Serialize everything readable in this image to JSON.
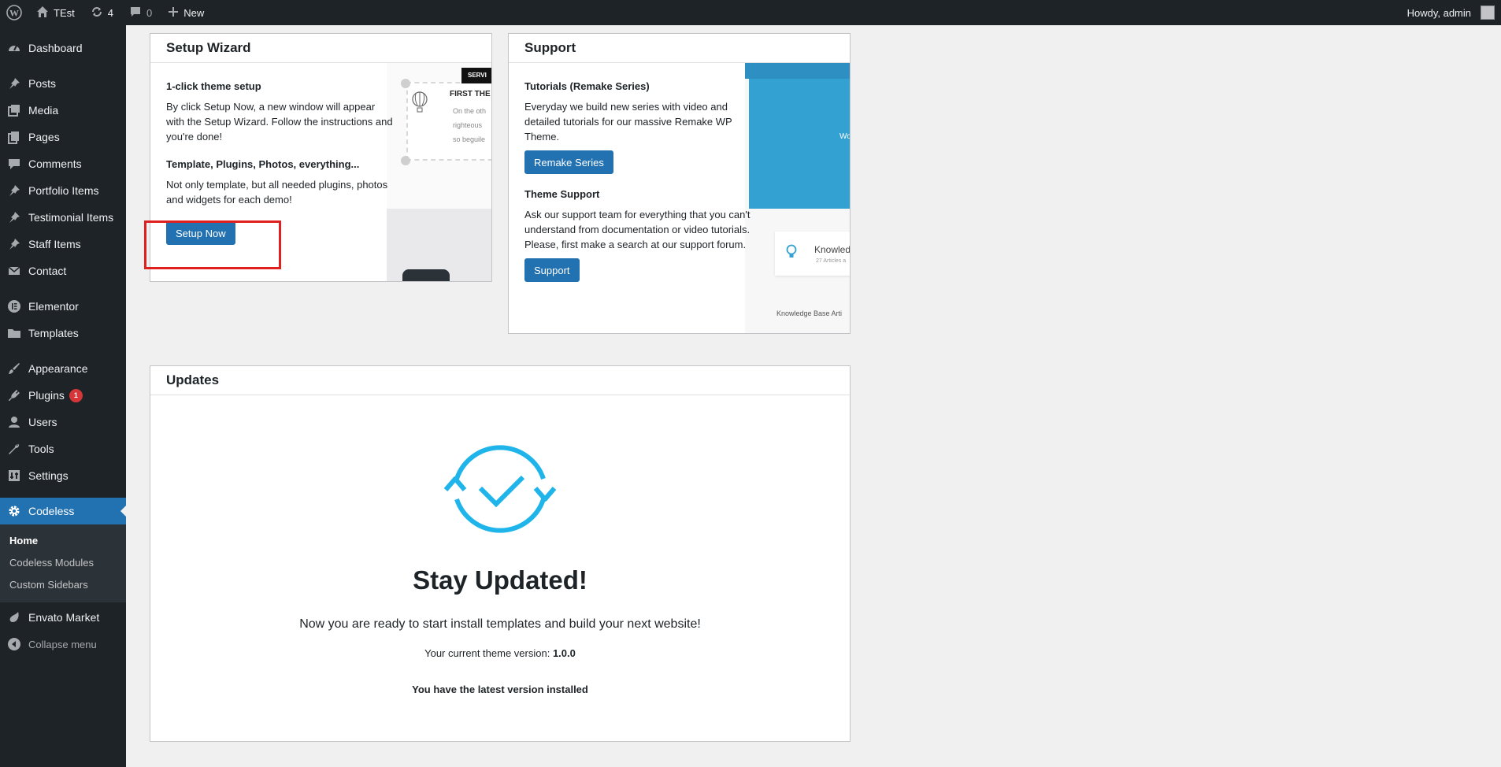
{
  "admin_bar": {
    "site_name": "TEst",
    "updates_count": "4",
    "comments_count": "0",
    "new_label": "New",
    "greeting": "Howdy, admin"
  },
  "sidebar": {
    "items": [
      {
        "label": "Dashboard",
        "icon": "dashboard-icon"
      },
      {
        "label": "Posts",
        "icon": "pin-icon"
      },
      {
        "label": "Media",
        "icon": "media-icon"
      },
      {
        "label": "Pages",
        "icon": "pages-icon"
      },
      {
        "label": "Comments",
        "icon": "comment-icon"
      },
      {
        "label": "Portfolio Items",
        "icon": "pin-icon"
      },
      {
        "label": "Testimonial Items",
        "icon": "pin-icon"
      },
      {
        "label": "Staff Items",
        "icon": "pin-icon"
      },
      {
        "label": "Contact",
        "icon": "mail-icon"
      },
      {
        "label": "Elementor",
        "icon": "elementor-icon"
      },
      {
        "label": "Templates",
        "icon": "folder-icon"
      },
      {
        "label": "Appearance",
        "icon": "brush-icon"
      },
      {
        "label": "Plugins",
        "icon": "plug-icon",
        "badge": "1"
      },
      {
        "label": "Users",
        "icon": "user-icon"
      },
      {
        "label": "Tools",
        "icon": "wrench-icon"
      },
      {
        "label": "Settings",
        "icon": "settings-icon"
      },
      {
        "label": "Codeless",
        "icon": "gear-icon"
      }
    ],
    "submenu": [
      "Home",
      "Codeless Modules",
      "Custom Sidebars"
    ],
    "envato": "Envato Market",
    "collapse": "Collapse menu"
  },
  "setup_wizard": {
    "title": "Setup Wizard",
    "h1": "1-click theme setup",
    "p1": "By click Setup Now, a new window will appear with the Setup Wizard. Follow the instructions and you're done!",
    "h2": "Template, Plugins, Photos, everything...",
    "p2": "Not only template, but all needed plugins, photos and widgets for each demo!",
    "button": "Setup Now",
    "illus": {
      "tag": "SERVI",
      "title": "FIRST THE",
      "l1": "On the oth",
      "l2": "righteous",
      "l3": "so beguile"
    }
  },
  "support": {
    "title": "Support",
    "h1": "Tutorials (Remake Series)",
    "p1": "Everyday we build new series with video and detailed tutorials for our massive Remake WP Theme.",
    "button1": "Remake Series",
    "h2": "Theme Support",
    "p2": "Ask our support team for everything that you can't understand from documentation or video tutorials. Please, first make a search at our support forum.",
    "button2": "Support",
    "illus": {
      "wo": "Wo",
      "kb_title": "Knowled",
      "kb_sub": "27 Articles a",
      "foot": "Knowledge Base Arti"
    }
  },
  "updates": {
    "title": "Updates",
    "heading": "Stay Updated!",
    "subtitle": "Now you are ready to start install templates and build your next website!",
    "version_label": "Your current theme version:",
    "version": "1.0.0",
    "status": "You have the latest version installed"
  },
  "colors": {
    "accent": "#2271b1",
    "sync_icon": "#1fb5ea",
    "highlight": "#e0201e"
  }
}
